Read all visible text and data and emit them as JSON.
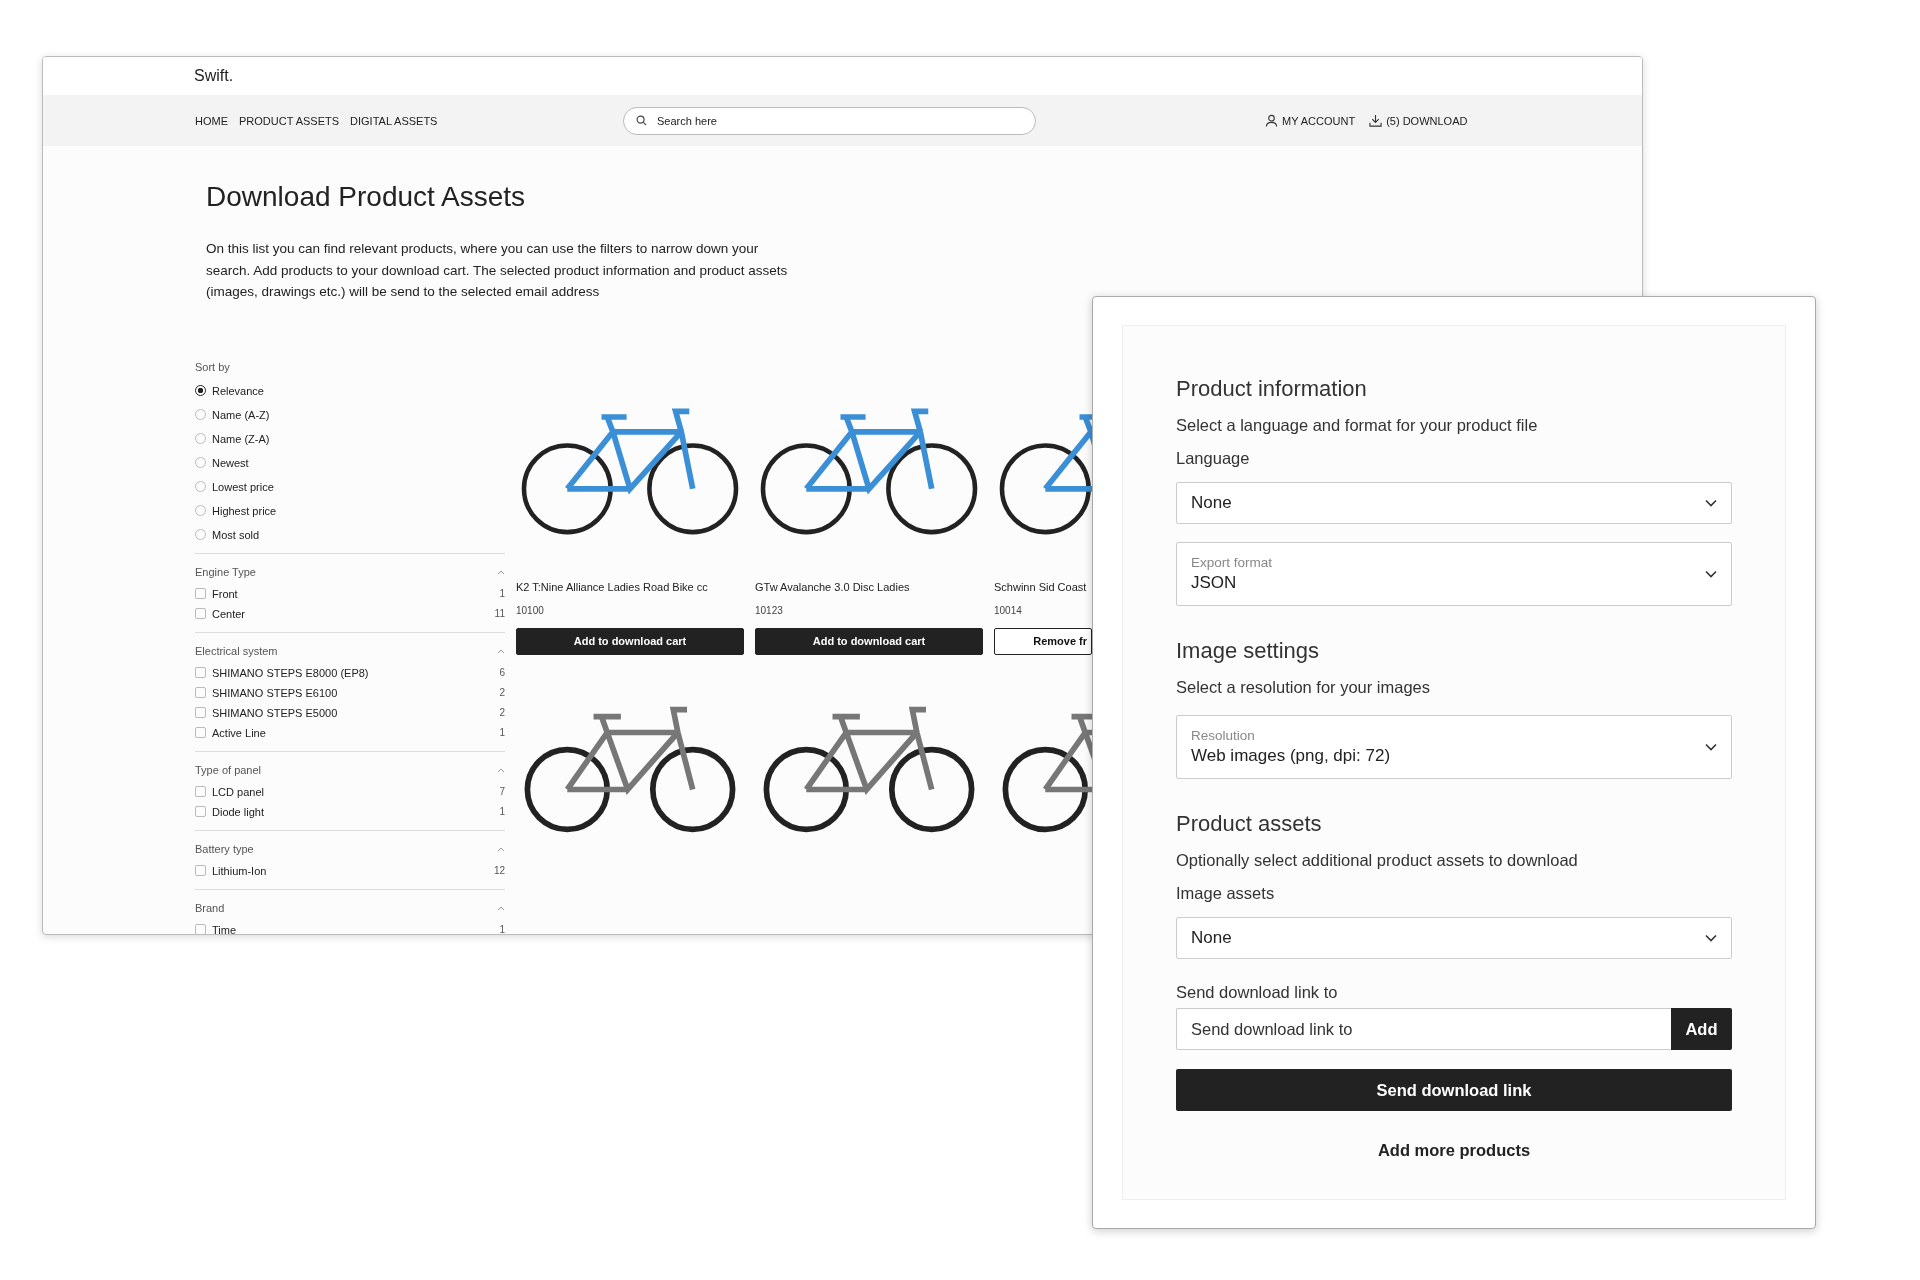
{
  "site": {
    "brand": "Swift.",
    "nav": [
      {
        "label": "HOME"
      },
      {
        "label": "PRODUCT ASSETS"
      },
      {
        "label": "DIGITAL ASSETS"
      }
    ],
    "search": {
      "placeholder": "Search here"
    },
    "account": "MY ACCOUNT",
    "download": "(5) DOWNLOAD"
  },
  "page_title": "Download Product Assets",
  "intro": "On this list you can find relevant products, where you can use the filters to narrow down your search. Add products to your download cart. The selected product information and product assets (images, drawings etc.) will be send to the selected email address",
  "sort": {
    "label": "Sort by",
    "options": [
      {
        "label": "Relevance",
        "selected": true
      },
      {
        "label": "Name (A-Z)",
        "selected": false
      },
      {
        "label": "Name (Z-A)",
        "selected": false
      },
      {
        "label": "Newest",
        "selected": false
      },
      {
        "label": "Lowest price",
        "selected": false
      },
      {
        "label": "Highest price",
        "selected": false
      },
      {
        "label": "Most sold",
        "selected": false
      }
    ]
  },
  "filters": [
    {
      "title": "Engine Type",
      "expanded": true,
      "options": [
        {
          "label": "Front",
          "count": "1",
          "checked": false
        },
        {
          "label": "Center",
          "count": "11",
          "checked": false
        }
      ]
    },
    {
      "title": "Electrical system",
      "expanded": true,
      "options": [
        {
          "label": "SHIMANO STEPS E8000 (EP8)",
          "count": "6",
          "checked": false
        },
        {
          "label": "SHIMANO STEPS E6100",
          "count": "2",
          "checked": false
        },
        {
          "label": "SHIMANO STEPS E5000",
          "count": "2",
          "checked": false
        },
        {
          "label": "Active Line",
          "count": "1",
          "checked": false
        }
      ]
    },
    {
      "title": "Type of panel",
      "expanded": true,
      "options": [
        {
          "label": "LCD panel",
          "count": "7",
          "checked": false
        },
        {
          "label": "Diode light",
          "count": "1",
          "checked": false
        }
      ]
    },
    {
      "title": "Battery type",
      "expanded": true,
      "options": [
        {
          "label": "Lithium-Ion",
          "count": "12",
          "checked": false
        }
      ]
    },
    {
      "title": "Brand",
      "expanded": true,
      "options": [
        {
          "label": "Time",
          "count": "1",
          "checked": false
        }
      ]
    }
  ],
  "products": [
    {
      "name": "K2 T:Nine Alliance Ladies Road Bike cc",
      "sku": "10100",
      "in_cart": false,
      "button": "Add to download cart"
    },
    {
      "name": "GTw Avalanche 3.0 Disc Ladies",
      "sku": "10123",
      "in_cart": false,
      "button": "Add to download cart"
    },
    {
      "name": "Schwinn Sid Coast",
      "sku": "10014",
      "in_cart": true,
      "button": "Remove fr"
    }
  ],
  "more_products": [
    {
      "kind": "bike-photo"
    },
    {
      "kind": "bike-photo"
    },
    {
      "kind": "bike-photo"
    }
  ],
  "panel": {
    "sections": [
      {
        "heading": "Product information",
        "subtitle": "Select a language and format for your product file",
        "fields": [
          {
            "kind": "select",
            "label": "Language",
            "value": "None"
          },
          {
            "kind": "floating-select",
            "label": "Export format",
            "value": "JSON"
          }
        ]
      },
      {
        "heading": "Image settings",
        "subtitle": "Select a resolution for your images",
        "fields": [
          {
            "kind": "floating-select",
            "label": "Resolution",
            "value": "Web images (png, dpi: 72)"
          }
        ]
      },
      {
        "heading": "Product assets",
        "subtitle": "Optionally select additional product assets to download",
        "fields": [
          {
            "kind": "select",
            "label": "Image assets",
            "value": "None"
          }
        ]
      }
    ],
    "email": {
      "label": "Send download link to",
      "placeholder": "Send download link to",
      "button": "Add"
    },
    "send_button": "Send download link",
    "more_link": "Add more products"
  }
}
